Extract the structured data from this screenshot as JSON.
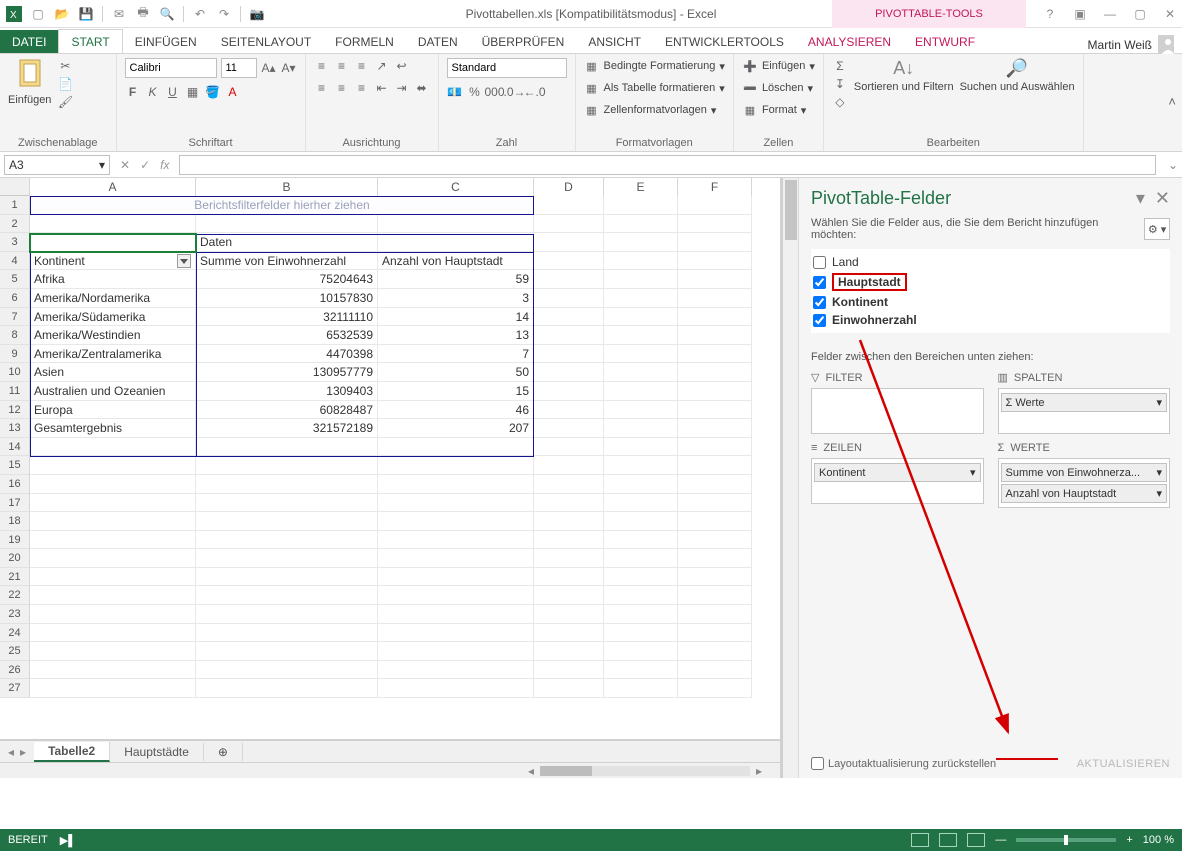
{
  "title": "Pivottabellen.xls  [Kompatibilitätsmodus] - Excel",
  "context_caption": "PIVOTTABLE-TOOLS",
  "user": "Martin Weiß",
  "tabs": {
    "file": "DATEI",
    "start": "START",
    "einfuegen": "EINFÜGEN",
    "seitenlayout": "SEITENLAYOUT",
    "formeln": "FORMELN",
    "daten": "DATEN",
    "ueberpruefen": "ÜBERPRÜFEN",
    "ansicht": "ANSICHT",
    "entwickler": "ENTWICKLERTOOLS",
    "analysieren": "ANALYSIEREN",
    "entwurf": "ENTWURF"
  },
  "ribbon": {
    "paste": "Einfügen",
    "clipboard": "Zwischenablage",
    "font_name": "Calibri",
    "font_size": "11",
    "font_group": "Schriftart",
    "align_group": "Ausrichtung",
    "number_format": "Standard",
    "number_group": "Zahl",
    "cond_fmt": "Bedingte Formatierung",
    "as_table": "Als Tabelle formatieren",
    "cell_styles": "Zellenformatvorlagen",
    "styles_group": "Formatvorlagen",
    "insert_cells": "Einfügen",
    "delete_cells": "Löschen",
    "format_cells": "Format",
    "cells_group": "Zellen",
    "sort_filter": "Sortieren und Filtern",
    "find_select": "Suchen und Auswählen",
    "editing_group": "Bearbeiten"
  },
  "cellref": "A3",
  "grid": {
    "cols": [
      "A",
      "B",
      "C",
      "D",
      "E",
      "F"
    ],
    "filter_hint": "Berichtsfilterfelder hierher ziehen",
    "r3b": "Daten",
    "r4a": "Kontinent",
    "r4b": "Summe von Einwohnerzahl",
    "r4c": "Anzahl von Hauptstadt",
    "rows": [
      {
        "a": "Afrika",
        "b": "75204643",
        "c": "59"
      },
      {
        "a": "Amerika/Nordamerika",
        "b": "10157830",
        "c": "3"
      },
      {
        "a": "Amerika/Südamerika",
        "b": "32111110",
        "c": "14"
      },
      {
        "a": "Amerika/Westindien",
        "b": "6532539",
        "c": "13"
      },
      {
        "a": "Amerika/Zentralamerika",
        "b": "4470398",
        "c": "7"
      },
      {
        "a": "Asien",
        "b": "130957779",
        "c": "50"
      },
      {
        "a": "Australien und Ozeanien",
        "b": "1309403",
        "c": "15"
      },
      {
        "a": "Europa",
        "b": "60828487",
        "c": "46"
      },
      {
        "a": "Gesamtergebnis",
        "b": "321572189",
        "c": "207"
      }
    ]
  },
  "sheets": {
    "active": "Tabelle2",
    "other": "Hauptstädte"
  },
  "pivot": {
    "title": "PivotTable-Felder",
    "subtitle": "Wählen Sie die Felder aus, die Sie dem Bericht hinzufügen möchten:",
    "f_land": "Land",
    "f_hauptstadt": "Hauptstadt",
    "f_kontinent": "Kontinent",
    "f_einwohner": "Einwohnerzahl",
    "drag_hint": "Felder zwischen den Bereichen unten ziehen:",
    "a_filter": "FILTER",
    "a_spalten": "SPALTEN",
    "a_zeilen": "ZEILEN",
    "a_werte": "WERTE",
    "pill_werte": "Werte",
    "pill_kontinent": "Kontinent",
    "pill_sum": "Summe von Einwohnerza...",
    "pill_anz": "Anzahl von Hauptstadt",
    "defer": "Layoutaktualisierung zurückstellen",
    "update": "AKTUALISIEREN"
  },
  "status": {
    "ready": "BEREIT",
    "zoom": "100 %"
  }
}
